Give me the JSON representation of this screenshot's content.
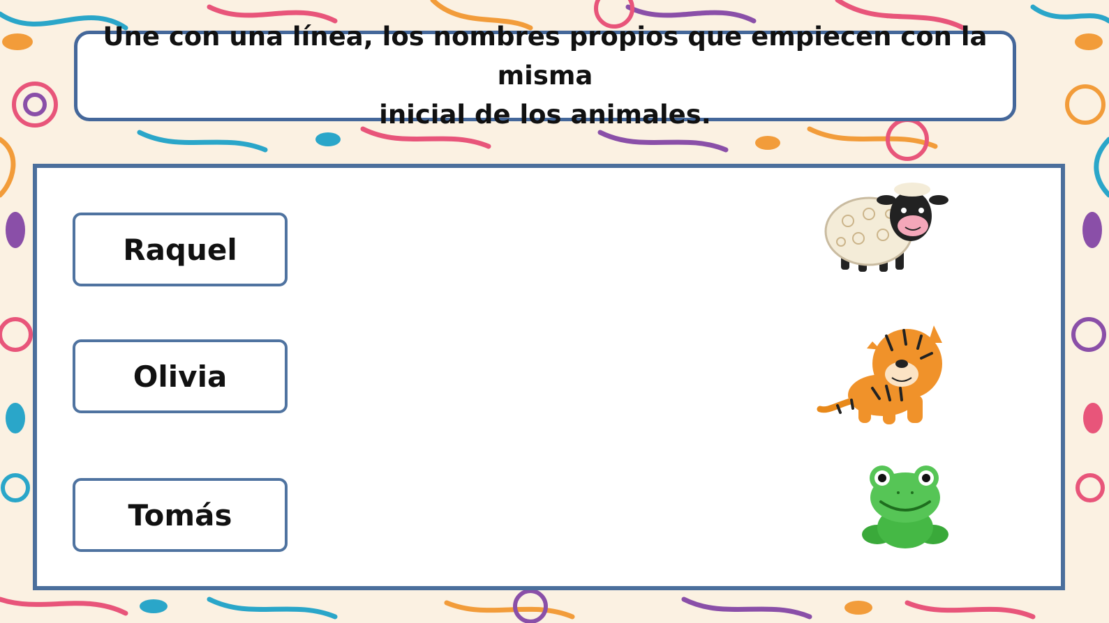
{
  "instruction": {
    "line1": "Une con una línea, los nombres propios que empiecen con la misma",
    "line2": "inicial de los animales."
  },
  "names": [
    "Raquel",
    "Olivia",
    "Tomás"
  ],
  "animals": [
    {
      "icon": "sheep-icon"
    },
    {
      "icon": "tiger-icon"
    },
    {
      "icon": "frog-icon"
    }
  ],
  "colors": {
    "border": "#4b6f9c",
    "background": "#fbf1e2"
  }
}
